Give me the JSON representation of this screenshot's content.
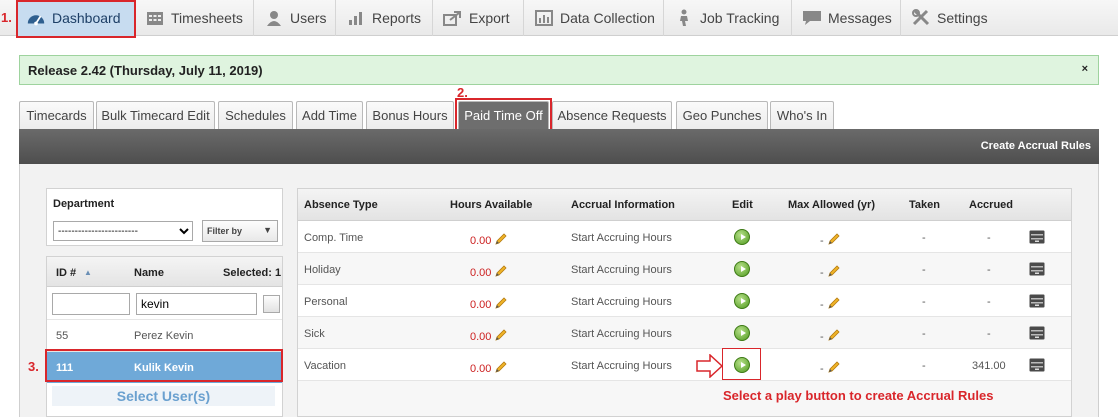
{
  "nav": {
    "items": [
      {
        "label": "Dashboard",
        "icon": "dashboard-gauge-icon",
        "active": true
      },
      {
        "label": "Timesheets",
        "icon": "calendar-icon"
      },
      {
        "label": "Users",
        "icon": "user-icon"
      },
      {
        "label": "Reports",
        "icon": "bar-chart-icon"
      },
      {
        "label": "Export",
        "icon": "export-arrow-icon"
      },
      {
        "label": "Data Collection",
        "icon": "data-collection-icon"
      },
      {
        "label": "Job Tracking",
        "icon": "job-tracking-icon"
      },
      {
        "label": "Messages",
        "icon": "speech-bubble-icon"
      },
      {
        "label": "Settings",
        "icon": "tools-icon"
      }
    ]
  },
  "annotations": {
    "step1": "1.",
    "step2": "2.",
    "step3": "3.",
    "select_users": "Select User(s)",
    "instruction": "Select a play button to create Accrual Rules"
  },
  "release": {
    "text": "Release 2.42 (Thursday, July 11, 2019)",
    "close": "×"
  },
  "tabs": [
    {
      "label": "Timecards"
    },
    {
      "label": "Bulk Timecard Edit"
    },
    {
      "label": "Schedules"
    },
    {
      "label": "Add Time"
    },
    {
      "label": "Bonus Hours"
    },
    {
      "label": "Paid Time Off",
      "active": true
    },
    {
      "label": "Absence Requests"
    },
    {
      "label": "Geo Punches"
    },
    {
      "label": "Who's In"
    }
  ],
  "toolbar": {
    "create_accrual_rules": "Create Accrual Rules"
  },
  "department": {
    "label": "Department",
    "selected": "------------------------",
    "filter_label": "Filter by",
    "filter_arrow": "▼"
  },
  "users": {
    "col_id": "ID #",
    "sort_indicator": "▲",
    "col_name": "Name",
    "selected_label": "Selected: 1",
    "search_id_value": "",
    "search_name_value": "kevin",
    "rows": [
      {
        "id": "55",
        "name": "Perez Kevin"
      },
      {
        "id": "111",
        "name": "Kulik Kevin",
        "selected": true
      }
    ]
  },
  "absence": {
    "headers": {
      "type": "Absence Type",
      "hours": "Hours Available",
      "accrual": "Accrual Information",
      "edit": "Edit",
      "max": "Max Allowed (yr)",
      "taken": "Taken",
      "accrued": "Accrued"
    },
    "rows": [
      {
        "type": "Comp. Time",
        "hours": "0.00",
        "accrual": "Start Accruing Hours",
        "max": "-",
        "taken": "-",
        "accrued": "-"
      },
      {
        "type": "Holiday",
        "hours": "0.00",
        "accrual": "Start Accruing Hours",
        "max": "-",
        "taken": "-",
        "accrued": "-"
      },
      {
        "type": "Personal",
        "hours": "0.00",
        "accrual": "Start Accruing Hours",
        "max": "-",
        "taken": "-",
        "accrued": "-"
      },
      {
        "type": "Sick",
        "hours": "0.00",
        "accrual": "Start Accruing Hours",
        "max": "-",
        "taken": "-",
        "accrued": "-"
      },
      {
        "type": "Vacation",
        "hours": "0.00",
        "accrual": "Start Accruing Hours",
        "max": "-",
        "taken": "-",
        "accrued": "341.00"
      }
    ]
  },
  "colors": {
    "annotation_red": "#d9262b",
    "active_nav": "#c7dcf0",
    "selected_row": "#6fa9d8",
    "banner_green": "#dff4df"
  }
}
